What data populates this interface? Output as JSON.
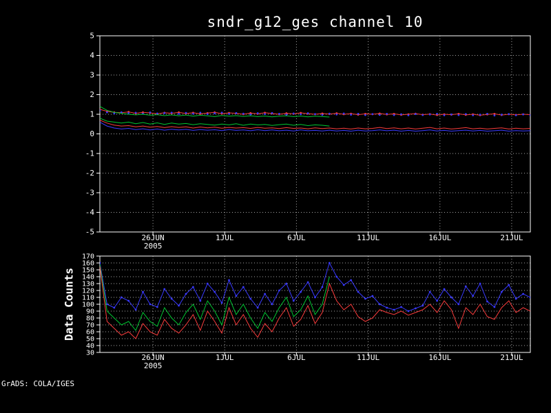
{
  "footer": "GrADS: COLA/IGES",
  "colors": {
    "background": "#000000",
    "frame": "#ffffff",
    "grid": "#a8a8a8",
    "text": "#ffffff",
    "red": "#fa3c3c",
    "green": "#00c832",
    "blue": "#3a3aff"
  },
  "chart_data": {
    "type": "line",
    "title": "sndr_g12_ges channel 10",
    "x_axis": {
      "min": 0,
      "max": 30,
      "ticks": [
        {
          "pos": 3.7,
          "label": "26JUN",
          "sub": "2005"
        },
        {
          "pos": 8.7,
          "label": "1JUL"
        },
        {
          "pos": 13.7,
          "label": "6JUL"
        },
        {
          "pos": 18.7,
          "label": "11JUL"
        },
        {
          "pos": 23.7,
          "label": "16JUL"
        },
        {
          "pos": 28.7,
          "label": "21JUL"
        }
      ]
    },
    "panels": [
      {
        "id": "top",
        "ylabel": "",
        "ylim": [
          -5,
          5
        ],
        "ytick_step": 1,
        "series": [
          {
            "name": "stdev-red",
            "color": "red",
            "line": true,
            "marker": true,
            "x0": 0,
            "dx": 0.5,
            "values": [
              1.25,
              1.15,
              1.1,
              1.08,
              1.12,
              1.05,
              1.1,
              1.07,
              1.02,
              1.08,
              1.05,
              1.1,
              1.04,
              1.08,
              1.02,
              1.06,
              1.1,
              1.03,
              1.07,
              1.05,
              1.0,
              1.06,
              1.02,
              1.08,
              1.04,
              1.0,
              1.05,
              1.02,
              1.07,
              1.03,
              1.0,
              1.04,
              1.01,
              1.05,
              1.0,
              1.03,
              0.98,
              1.02,
              1.0,
              1.04,
              0.99,
              1.02,
              0.97,
              1.0,
              1.03,
              0.98,
              1.01,
              0.96,
              1.0,
              0.98,
              1.02,
              0.97,
              1.0,
              0.95,
              0.99,
              1.02,
              0.96,
              1.0,
              0.97,
              1.0,
              0.98
            ]
          },
          {
            "name": "stdev-blue-dots",
            "color": "blue",
            "line": false,
            "marker": true,
            "x0": 0,
            "dx": 0.5,
            "values": [
              1.2,
              1.1,
              1.05,
              1.1,
              1.06,
              1.08,
              1.03,
              1.09,
              1.04,
              1.06,
              1.08,
              1.02,
              1.07,
              1.03,
              1.08,
              1.01,
              1.05,
              1.08,
              1.02,
              1.06,
              1.03,
              0.99,
              1.05,
              1.01,
              1.06,
              1.02,
              0.98,
              1.04,
              1.0,
              1.05,
              1.01,
              0.97,
              1.03,
              0.99,
              1.04,
              0.98,
              1.02,
              0.96,
              1.01,
              0.97,
              1.02,
              0.96,
              1.0,
              0.95,
              1.01,
              0.96,
              0.99,
              1.02,
              0.95,
              0.99,
              0.96,
              1.01,
              0.95,
              0.98,
              1.02,
              0.94,
              0.98,
              1.01,
              0.95,
              0.99,
              0.96
            ]
          },
          {
            "name": "stdev-green",
            "color": "green",
            "line": true,
            "marker": false,
            "x0": 0,
            "dx": 0.5,
            "values": [
              1.4,
              1.2,
              1.1,
              1.05,
              1.0,
              0.97,
              1.0,
              0.95,
              0.98,
              0.93,
              0.97,
              0.92,
              0.96,
              0.9,
              0.95,
              0.92,
              0.88,
              0.94,
              0.9,
              0.93,
              0.89,
              0.92,
              0.88,
              0.91,
              0.87,
              0.9,
              0.92,
              0.88,
              0.91,
              0.87,
              0.9,
              0.88,
              0.86
            ]
          },
          {
            "name": "mean-green",
            "color": "green",
            "line": true,
            "marker": false,
            "x0": 0,
            "dx": 0.5,
            "values": [
              0.8,
              0.65,
              0.6,
              0.55,
              0.6,
              0.52,
              0.58,
              0.5,
              0.56,
              0.48,
              0.55,
              0.5,
              0.53,
              0.47,
              0.52,
              0.48,
              0.45,
              0.5,
              0.46,
              0.52,
              0.44,
              0.5,
              0.46,
              0.48,
              0.43,
              0.47,
              0.5,
              0.44,
              0.48,
              0.42,
              0.46,
              0.44,
              0.4
            ]
          },
          {
            "name": "mean-red",
            "color": "red",
            "line": true,
            "marker": false,
            "x0": 0,
            "dx": 0.5,
            "values": [
              0.7,
              0.55,
              0.45,
              0.4,
              0.42,
              0.36,
              0.4,
              0.34,
              0.38,
              0.32,
              0.37,
              0.33,
              0.36,
              0.3,
              0.35,
              0.31,
              0.34,
              0.29,
              0.33,
              0.3,
              0.32,
              0.28,
              0.33,
              0.29,
              0.31,
              0.27,
              0.32,
              0.28,
              0.3,
              0.26,
              0.31,
              0.27,
              0.3,
              0.26,
              0.29,
              0.25,
              0.3,
              0.26,
              0.28,
              0.33,
              0.27,
              0.31,
              0.26,
              0.3,
              0.25,
              0.29,
              0.33,
              0.26,
              0.3,
              0.25,
              0.28,
              0.32,
              0.26,
              0.29,
              0.25,
              0.28,
              0.31,
              0.25,
              0.29,
              0.26,
              0.28
            ]
          },
          {
            "name": "mean-blue",
            "color": "blue",
            "line": true,
            "marker": false,
            "x0": 0,
            "dx": 0.5,
            "values": [
              0.6,
              0.4,
              0.3,
              0.25,
              0.28,
              0.22,
              0.26,
              0.2,
              0.25,
              0.19,
              0.24,
              0.2,
              0.23,
              0.18,
              0.22,
              0.19,
              0.21,
              0.17,
              0.22,
              0.18,
              0.2,
              0.16,
              0.21,
              0.17,
              0.2,
              0.16,
              0.19,
              0.15,
              0.2,
              0.16,
              0.18,
              0.15,
              0.19,
              0.15,
              0.18,
              0.14,
              0.19,
              0.15,
              0.17,
              0.2,
              0.16,
              0.19,
              0.14,
              0.18,
              0.14,
              0.17,
              0.2,
              0.15,
              0.18,
              0.14,
              0.17,
              0.19,
              0.15,
              0.18,
              0.14,
              0.16,
              0.19,
              0.14,
              0.17,
              0.15,
              0.16
            ]
          }
        ]
      },
      {
        "id": "bottom",
        "ylabel": "Data Counts",
        "ylim": [
          30,
          170
        ],
        "ytick_step": 10,
        "series": [
          {
            "name": "counts-blue",
            "color": "blue",
            "line": true,
            "marker": true,
            "x0": 0,
            "dx": 0.5,
            "values": [
              160,
              100,
              95,
              110,
              105,
              92,
              118,
              100,
              96,
              122,
              108,
              98,
              115,
              125,
              105,
              130,
              118,
              102,
              135,
              112,
              125,
              108,
              95,
              115,
              100,
              120,
              130,
              105,
              118,
              132,
              110,
              125,
              160,
              140,
              128,
              135,
              118,
              108,
              112,
              100,
              95,
              92,
              96,
              90,
              94,
              98,
              118,
              105,
              122,
              110,
              100,
              126,
              112,
              130,
              104,
              96,
              118,
              128,
              108,
              115,
              110
            ]
          },
          {
            "name": "counts-green",
            "color": "green",
            "line": true,
            "marker": false,
            "x0": 0,
            "dx": 0.5,
            "values": [
              158,
              90,
              80,
              70,
              75,
              62,
              88,
              75,
              68,
              95,
              80,
              70,
              88,
              100,
              78,
              105,
              90,
              70,
              110,
              85,
              100,
              80,
              65,
              88,
              75,
              95,
              110,
              82,
              92,
              112,
              85,
              100,
              140
            ]
          },
          {
            "name": "counts-red",
            "color": "red",
            "line": true,
            "marker": false,
            "x0": 0,
            "dx": 0.5,
            "values": [
              155,
              75,
              65,
              55,
              60,
              50,
              72,
              60,
              55,
              78,
              65,
              58,
              70,
              85,
              62,
              90,
              75,
              58,
              95,
              70,
              85,
              65,
              52,
              72,
              60,
              80,
              95,
              68,
              78,
              98,
              72,
              88,
              130,
              105,
              92,
              100,
              82,
              75,
              80,
              92,
              88,
              85,
              90,
              84,
              88,
              92,
              100,
              88,
              105,
              92,
              65,
              95,
              85,
              100,
              82,
              78,
              95,
              105,
              88,
              95,
              90
            ]
          }
        ]
      }
    ]
  }
}
